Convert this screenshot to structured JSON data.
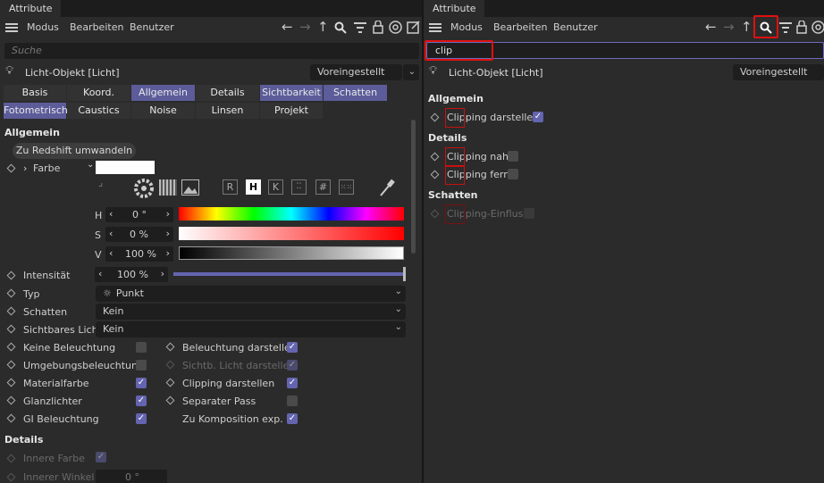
{
  "left": {
    "tab": "Attribute",
    "menu": [
      "Modus",
      "Bearbeiten",
      "Benutzer"
    ],
    "search_placeholder": "Suche",
    "object_title": "Licht-Objekt [Licht]",
    "preset": "Voreingestellt",
    "tabs_row1": [
      "Basis",
      "Koord.",
      "Allgemein",
      "Details",
      "Sichtbarkeit",
      "Schatten"
    ],
    "tabs_row2": [
      "Fotometrisch",
      "Caustics",
      "Noise",
      "Linsen",
      "Projekt"
    ],
    "section_allgemein": "Allgemein",
    "redshift_button": "Zu Redshift umwandeln",
    "farbe_label": "Farbe",
    "color_modes": [
      "R",
      "H",
      "K"
    ],
    "hsv": {
      "h_label": "H",
      "h_value": "0 °",
      "s_label": "S",
      "s_value": "0 %",
      "v_label": "V",
      "v_value": "100 %"
    },
    "intensitaet_label": "Intensität",
    "intensitaet_value": "100 %",
    "intensitaet_level": 1.0,
    "typ_label": "Typ",
    "typ_value": "Punkt",
    "schatten_label": "Schatten",
    "schatten_value": "Kein",
    "sichtbares_label": "Sichtbares Licht",
    "sichtbares_value": "Kein",
    "checks_left": [
      {
        "label": "Keine Beleuchtung",
        "checked": false
      },
      {
        "label": "Umgebungsbeleuchtung",
        "checked": false
      },
      {
        "label": "Materialfarbe",
        "checked": true
      },
      {
        "label": "Glanzlichter",
        "checked": true
      },
      {
        "label": "GI Beleuchtung",
        "checked": true
      }
    ],
    "checks_right": [
      {
        "label": "Beleuchtung darstellen",
        "checked": true,
        "dim": false
      },
      {
        "label": "Sichtb. Licht darstellen",
        "checked": true,
        "dim": true
      },
      {
        "label": "Clipping darstellen",
        "checked": true,
        "dim": false
      },
      {
        "label": "Separater Pass",
        "checked": false,
        "dim": false
      },
      {
        "label": "Zu Komposition exp.",
        "checked": true,
        "dim": false
      }
    ],
    "section_details": "Details",
    "innere_farbe": "Innere Farbe",
    "innerer_winkel": "Innerer Winkel",
    "innerer_winkel_value": "0 °"
  },
  "right": {
    "tab": "Attribute",
    "menu": [
      "Modus",
      "Bearbeiten",
      "Benutzer"
    ],
    "search_value": "clip",
    "object_title": "Licht-Objekt [Licht]",
    "preset": "Voreingestellt",
    "section_allgemein": "Allgemein",
    "clipping_darstellen": "Clipping darstellen",
    "section_details": "Details",
    "clipping_nah": "Clipping nah",
    "clipping_fern": "Clipping fern",
    "section_schatten": "Schatten",
    "clipping_einfluss": "Clipping-Einfluss"
  },
  "colors": {
    "accent": "#5c5c9a",
    "highlight": "#e01010"
  }
}
